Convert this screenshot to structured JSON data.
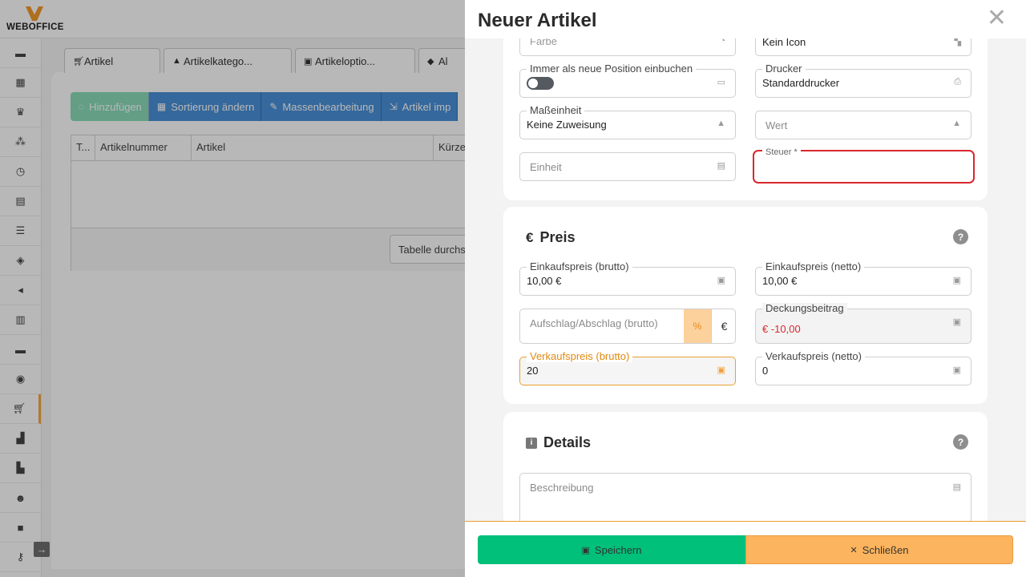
{
  "app": {
    "logo_text": "WEBOFFICE"
  },
  "background": {
    "tabs": [
      {
        "icon": "cart-icon",
        "label": "Artikel"
      },
      {
        "icon": "shapes-icon",
        "label": "Artikelkatego..."
      },
      {
        "icon": "options-icon",
        "label": "Artikeloptio..."
      },
      {
        "icon": "tag-icon",
        "label": "Al"
      }
    ],
    "buttons": [
      {
        "label": "Hinzufügen"
      },
      {
        "label": "Sortierung ändern"
      },
      {
        "label": "Massenbearbeitung"
      },
      {
        "label": "Artikel imp"
      }
    ],
    "columns": [
      "T...",
      "Artikelnummer",
      "Artikel",
      "Kürze"
    ],
    "footer_button": "Tabelle durchs"
  },
  "modal": {
    "title": "Neuer Artikel",
    "top_fields": {
      "farbe": {
        "label": "Farbe"
      },
      "icon": {
        "value": "Kein Icon"
      },
      "immer": {
        "label": "Immer als neue Position einbuchen"
      },
      "drucker": {
        "label": "Drucker",
        "value": "Standarddrucker"
      },
      "masseinheit": {
        "label": "Maßeinheit",
        "value": "Keine Zuweisung"
      },
      "wert": {
        "placeholder": "Wert"
      },
      "einheit": {
        "placeholder": "Einheit"
      },
      "steuer": {
        "label": "Steuer *"
      }
    },
    "preis": {
      "title": "Preis",
      "help": "?",
      "ek_brutto": {
        "label": "Einkaufspreis (brutto)",
        "value": "10,00 €"
      },
      "ek_netto": {
        "label": "Einkaufspreis (netto)",
        "value": "10,00 €"
      },
      "aufschlag": {
        "placeholder": "Aufschlag/Abschlag (brutto)",
        "pct": "%",
        "eur": "€"
      },
      "deckungsbeitrag": {
        "label": "Deckungsbeitrag",
        "value": "€ -10,00"
      },
      "vk_brutto": {
        "label": "Verkaufspreis (brutto)",
        "value": "20"
      },
      "vk_netto": {
        "label": "Verkaufspreis (netto)",
        "value": "0"
      }
    },
    "details": {
      "title": "Details",
      "help": "?",
      "beschreibung": {
        "placeholder": "Beschreibung"
      }
    },
    "footer": {
      "save": "Speichern",
      "close": "Schließen"
    }
  },
  "colors": {
    "accent": "#f7a540",
    "save": "#00c07a",
    "close": "#fdb45e",
    "error": "#d9272e",
    "negative": "#d9272e"
  }
}
